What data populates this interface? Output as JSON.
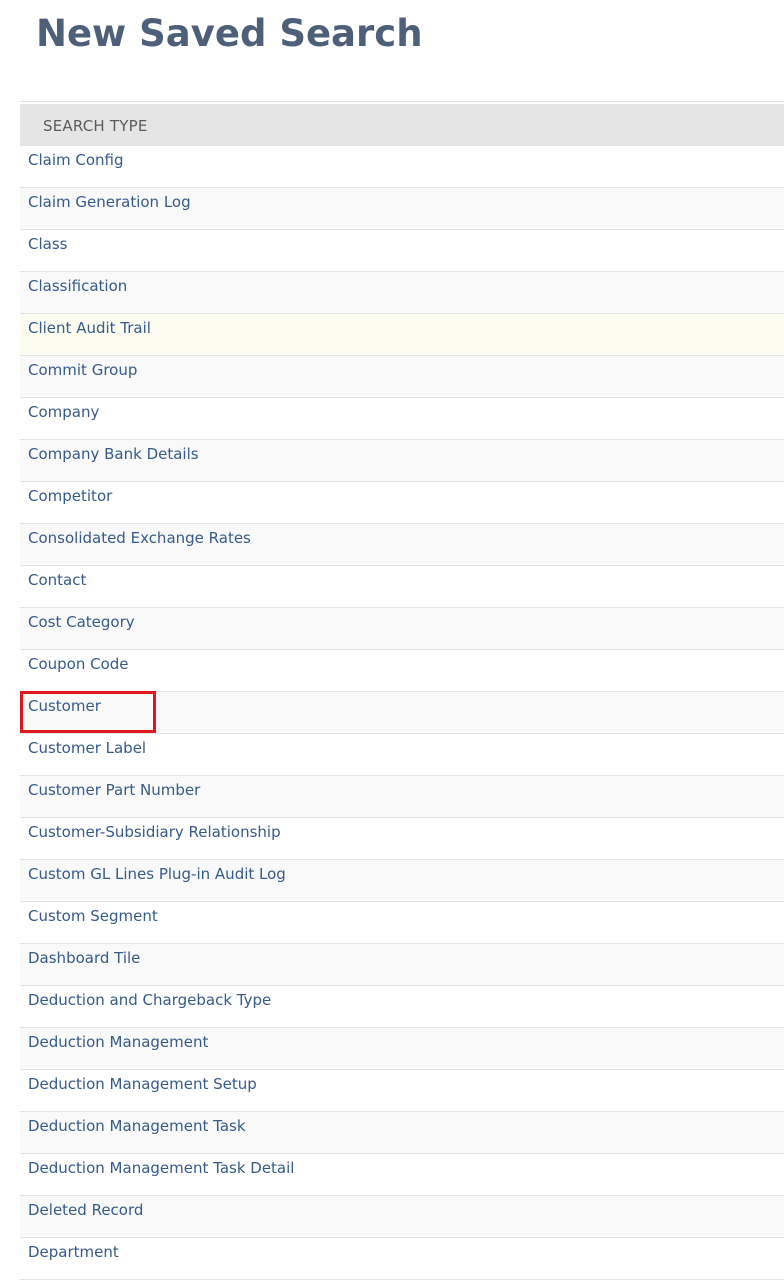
{
  "page": {
    "title": "New Saved Search"
  },
  "table": {
    "header": "SEARCH TYPE",
    "rows": [
      {
        "label": "Claim Config"
      },
      {
        "label": "Claim Generation Log"
      },
      {
        "label": "Class"
      },
      {
        "label": "Classification"
      },
      {
        "label": "Client Audit Trail"
      },
      {
        "label": "Commit Group"
      },
      {
        "label": "Company"
      },
      {
        "label": "Company Bank Details"
      },
      {
        "label": "Competitor"
      },
      {
        "label": "Consolidated Exchange Rates"
      },
      {
        "label": "Contact"
      },
      {
        "label": "Cost Category"
      },
      {
        "label": "Coupon Code"
      },
      {
        "label": "Customer"
      },
      {
        "label": "Customer Label"
      },
      {
        "label": "Customer Part Number"
      },
      {
        "label": "Customer-Subsidiary Relationship"
      },
      {
        "label": "Custom GL Lines Plug-in Audit Log"
      },
      {
        "label": "Custom Segment"
      },
      {
        "label": "Dashboard Tile"
      },
      {
        "label": "Deduction and Chargeback Type"
      },
      {
        "label": "Deduction Management"
      },
      {
        "label": "Deduction Management Setup"
      },
      {
        "label": "Deduction Management Task"
      },
      {
        "label": "Deduction Management Task Detail"
      },
      {
        "label": "Deleted Record"
      },
      {
        "label": "Department"
      }
    ]
  },
  "colors": {
    "title": "#4d5f79",
    "link": "#355a8c",
    "header_bg": "#e5e5e5",
    "hover_row_bg": "#fcfdf0",
    "selection_outline": "#e0181c"
  }
}
